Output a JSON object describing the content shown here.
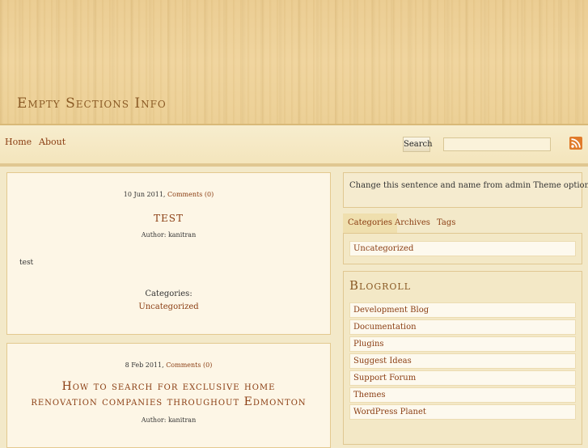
{
  "site": {
    "title": "Empty Sections Info"
  },
  "nav": {
    "home": "Home",
    "about": "About"
  },
  "search": {
    "button_label": "Search",
    "value": "",
    "placeholder": ""
  },
  "icons": {
    "rss": "rss-icon"
  },
  "colors": {
    "link": "#8a3d12",
    "title": "#8a5a25",
    "rss": "#e07a2a"
  },
  "posts": [
    {
      "date": "10 Jun 2011,",
      "comments": "Comments (0)",
      "title": "TEST",
      "author": "Author: kanitran",
      "body": "test",
      "categories_label": "Categories:",
      "category": "Uncategorized"
    },
    {
      "date": "8 Feb 2011,",
      "comments": "Comments (0)",
      "title_line1": "How to search for exclusive home",
      "title_line2": "renovation companies throughout Edmonton",
      "author": "Author: kanitran"
    }
  ],
  "sidebar": {
    "notice": "Change this sentence and name from admin Theme option page.",
    "tabs": [
      {
        "label": "Categories",
        "active": true
      },
      {
        "label": "Archives",
        "active": false
      },
      {
        "label": "Tags",
        "active": false
      }
    ],
    "tab_items": [
      "Uncategorized"
    ],
    "blogroll_title": "Blogroll",
    "blogroll": [
      "Development Blog",
      "Documentation",
      "Plugins",
      "Suggest Ideas",
      "Support Forum",
      "Themes",
      "WordPress Planet"
    ]
  }
}
